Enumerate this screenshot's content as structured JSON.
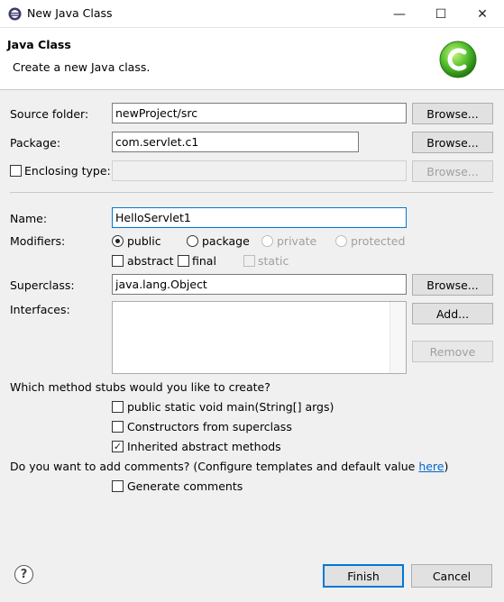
{
  "window": {
    "title": "New Java Class",
    "minimize": "—",
    "maximize": "☐",
    "close": "✕"
  },
  "banner": {
    "title": "Java Class",
    "description": "Create a new Java class."
  },
  "source_folder": {
    "label": "Source folder:",
    "value": "newProject/src",
    "browse": "Browse..."
  },
  "package": {
    "label": "Package:",
    "value": "com.servlet.c1",
    "browse": "Browse..."
  },
  "enclosing": {
    "label": "Enclosing type:",
    "value": "",
    "browse": "Browse..."
  },
  "name": {
    "label": "Name:",
    "value": "HelloServlet1"
  },
  "modifiers": {
    "label": "Modifiers:",
    "public": "public",
    "package": "package",
    "private": "private",
    "protected": "protected",
    "abstract": "abstract",
    "final": "final",
    "static": "static"
  },
  "superclass": {
    "label": "Superclass:",
    "value": "java.lang.Object",
    "browse": "Browse..."
  },
  "interfaces": {
    "label": "Interfaces:",
    "add": "Add...",
    "remove": "Remove"
  },
  "stubs": {
    "question": "Which method stubs would you like to create?",
    "main": "public static void main(String[] args)",
    "constructors": "Constructors from superclass",
    "inherited": "Inherited abstract methods"
  },
  "comments": {
    "question": "Do you want to add comments? (Configure templates and default value ",
    "link": "here",
    "close": ")",
    "generate": "Generate comments"
  },
  "footer": {
    "help": "?",
    "finish": "Finish",
    "cancel": "Cancel"
  }
}
